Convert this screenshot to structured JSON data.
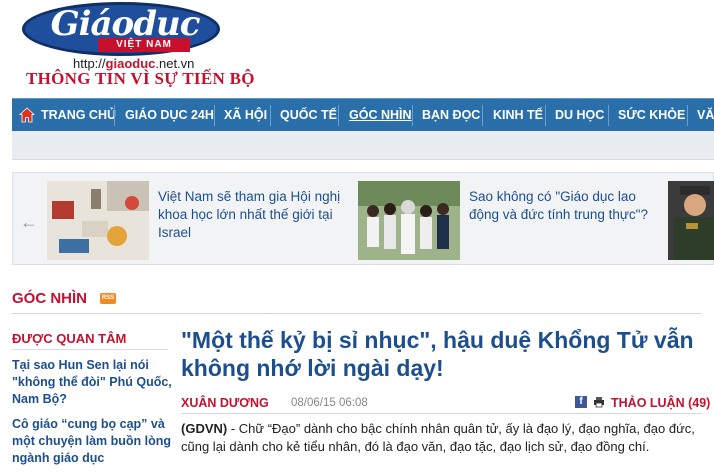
{
  "brand": {
    "logo_word": "Giáoduc",
    "logo_sub": "VIỆT NAM",
    "url_prefix": "http://",
    "url_domain": "giaoduc",
    "url_suffix": ".net.vn",
    "tagline": "THÔNG TIN VÌ SỰ TIẾN BỘ"
  },
  "nav": {
    "items": [
      "TRANG CHỦ",
      "GIÁO DỤC 24H",
      "XÃ HỘI",
      "QUỐC TẾ",
      "GÓC NHÌN",
      "BẠN ĐỌC",
      "KINH TẾ",
      "DU HỌC",
      "SỨC KHỎE",
      "VĂN"
    ],
    "active": "GÓC NHÌN"
  },
  "carousel": {
    "arrow": "←",
    "cards": [
      {
        "title": "Việt Nam sẽ tham gia Hội nghị khoa học lớn nhất thế giới tại Israel"
      },
      {
        "title": "Sao không có \"Giáo dục lao động và đức tính trung thực\"?"
      }
    ]
  },
  "section": {
    "title": "GÓC NHÌN",
    "rss": "RSS"
  },
  "sidebar": {
    "heading": "ĐƯỢC QUAN TÂM",
    "items": [
      "Tại sao Hun Sen lại nói \"không thể đòi\" Phú Quốc, Nam Bộ?",
      "Cô giáo “cung bọ cạp” và một chuyện làm buồn lòng ngành giáo dục"
    ]
  },
  "article": {
    "headline": "\"Một thế kỷ bị sỉ nhục\", hậu duệ Khổng Tử vẫn không nhớ lời ngài dạy!",
    "author": "XUÂN DƯƠNG",
    "date": "08/06/15 06:08",
    "discuss": "THẢO LUẬN (49)",
    "lead_prefix": "(GDVN)",
    "lead_body": " - Chữ “Đạo” dành cho bậc chính nhân quân tử, ấy là đạo lý, đạo nghĩa, đạo đức, cũng lại dành cho kẻ tiểu nhân, đó là đạo văn, đạo tặc, đạo lịch sử, đạo đồng chí."
  },
  "colors": {
    "nav_bg": "#2a6fa9",
    "brand_red": "#c8102e",
    "link_blue": "#1d4f8e"
  }
}
